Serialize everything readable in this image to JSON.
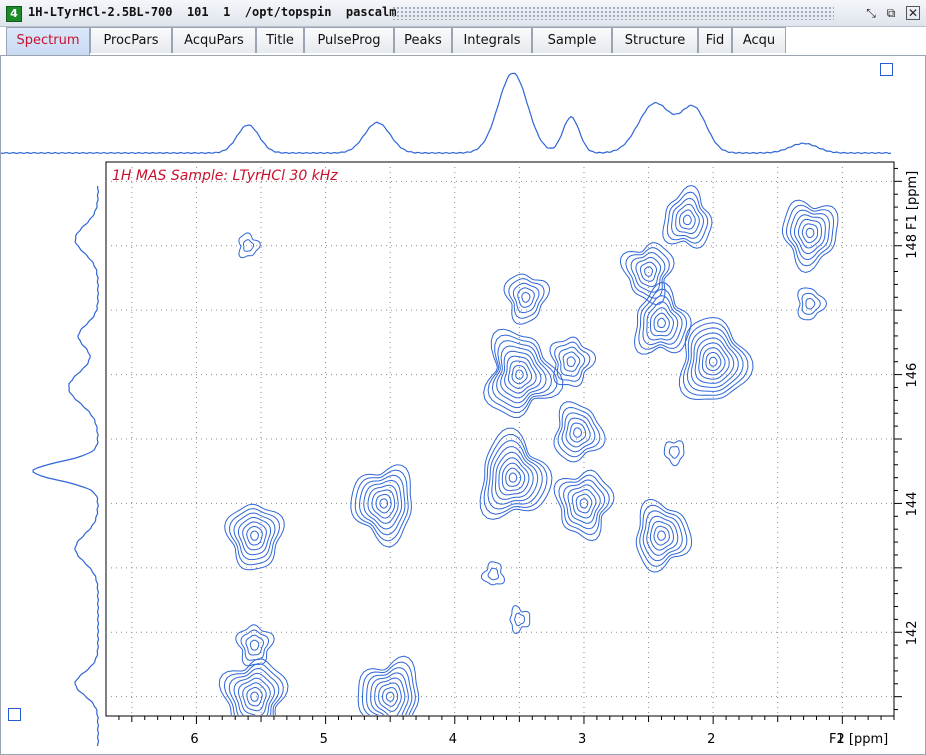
{
  "window": {
    "number": "4",
    "title": "1H-LTyrHCl-2.5BL-700  101  1  /opt/topspin  pascalm"
  },
  "tabs": [
    {
      "label": "Spectrum",
      "active": true
    },
    {
      "label": "ProcPars"
    },
    {
      "label": "AcquPars"
    },
    {
      "label": "Title"
    },
    {
      "label": "PulseProg"
    },
    {
      "label": "Peaks"
    },
    {
      "label": "Integrals"
    },
    {
      "label": "Sample"
    },
    {
      "label": "Structure"
    },
    {
      "label": "Fid"
    },
    {
      "label": "Acqu"
    }
  ],
  "spectrum": {
    "annotation": "1H MAS  Sample: LTyrHCl 30 kHz",
    "x_axis_label": "F2 [ppm]",
    "y_axis_label": "F1 [ppm]",
    "x_ticks": [
      "6",
      "5",
      "4",
      "3",
      "2",
      "1"
    ],
    "y_ticks": [
      "148",
      "146",
      "144",
      "142"
    ],
    "colors": {
      "contour": "#2f66d6",
      "annotation": "#c8102e",
      "axis": "#000000"
    }
  },
  "chart_data": {
    "type": "contour",
    "xlabel": "F2 [ppm]",
    "ylabel": "F1 [ppm]",
    "xlim": [
      6.7,
      0.6
    ],
    "ylim": [
      140.7,
      149.3
    ],
    "x_ticks": [
      6,
      5,
      4,
      3,
      2,
      1
    ],
    "y_ticks": [
      148,
      146,
      144,
      142
    ],
    "grid": true,
    "f2_projection_peaks_ppm": [
      5.6,
      4.6,
      3.55,
      3.1,
      2.45,
      2.15,
      1.3
    ],
    "f1_projection_peaks_ppm": [
      148.1,
      146.6,
      145.8,
      144.5,
      143.3,
      141.2
    ],
    "peaks": [
      {
        "f2": 5.55,
        "f1": 143.5,
        "levels": 7
      },
      {
        "f2": 5.55,
        "f1": 141.8,
        "levels": 4
      },
      {
        "f2": 5.55,
        "f1": 141.0,
        "levels": 8
      },
      {
        "f2": 4.55,
        "f1": 144.0,
        "levels": 8
      },
      {
        "f2": 4.5,
        "f1": 141.0,
        "levels": 8
      },
      {
        "f2": 3.5,
        "f1": 146.0,
        "levels": 9
      },
      {
        "f2": 3.55,
        "f1": 144.4,
        "levels": 9
      },
      {
        "f2": 3.45,
        "f1": 147.2,
        "levels": 5
      },
      {
        "f2": 3.05,
        "f1": 145.1,
        "levels": 6
      },
      {
        "f2": 3.0,
        "f1": 144.0,
        "levels": 7
      },
      {
        "f2": 3.1,
        "f1": 146.2,
        "levels": 5
      },
      {
        "f2": 2.4,
        "f1": 143.5,
        "levels": 7
      },
      {
        "f2": 2.5,
        "f1": 147.6,
        "levels": 6
      },
      {
        "f2": 2.0,
        "f1": 146.2,
        "levels": 9
      },
      {
        "f2": 2.4,
        "f1": 146.8,
        "levels": 7
      },
      {
        "f2": 2.2,
        "f1": 148.4,
        "levels": 6
      },
      {
        "f2": 1.25,
        "f1": 148.2,
        "levels": 7
      },
      {
        "f2": 1.25,
        "f1": 147.1,
        "levels": 3
      },
      {
        "f2": 3.5,
        "f1": 142.2,
        "levels": 2
      },
      {
        "f2": 3.7,
        "f1": 142.9,
        "levels": 2
      },
      {
        "f2": 2.3,
        "f1": 144.8,
        "levels": 2
      },
      {
        "f2": 5.6,
        "f1": 148.0,
        "levels": 2
      }
    ]
  }
}
